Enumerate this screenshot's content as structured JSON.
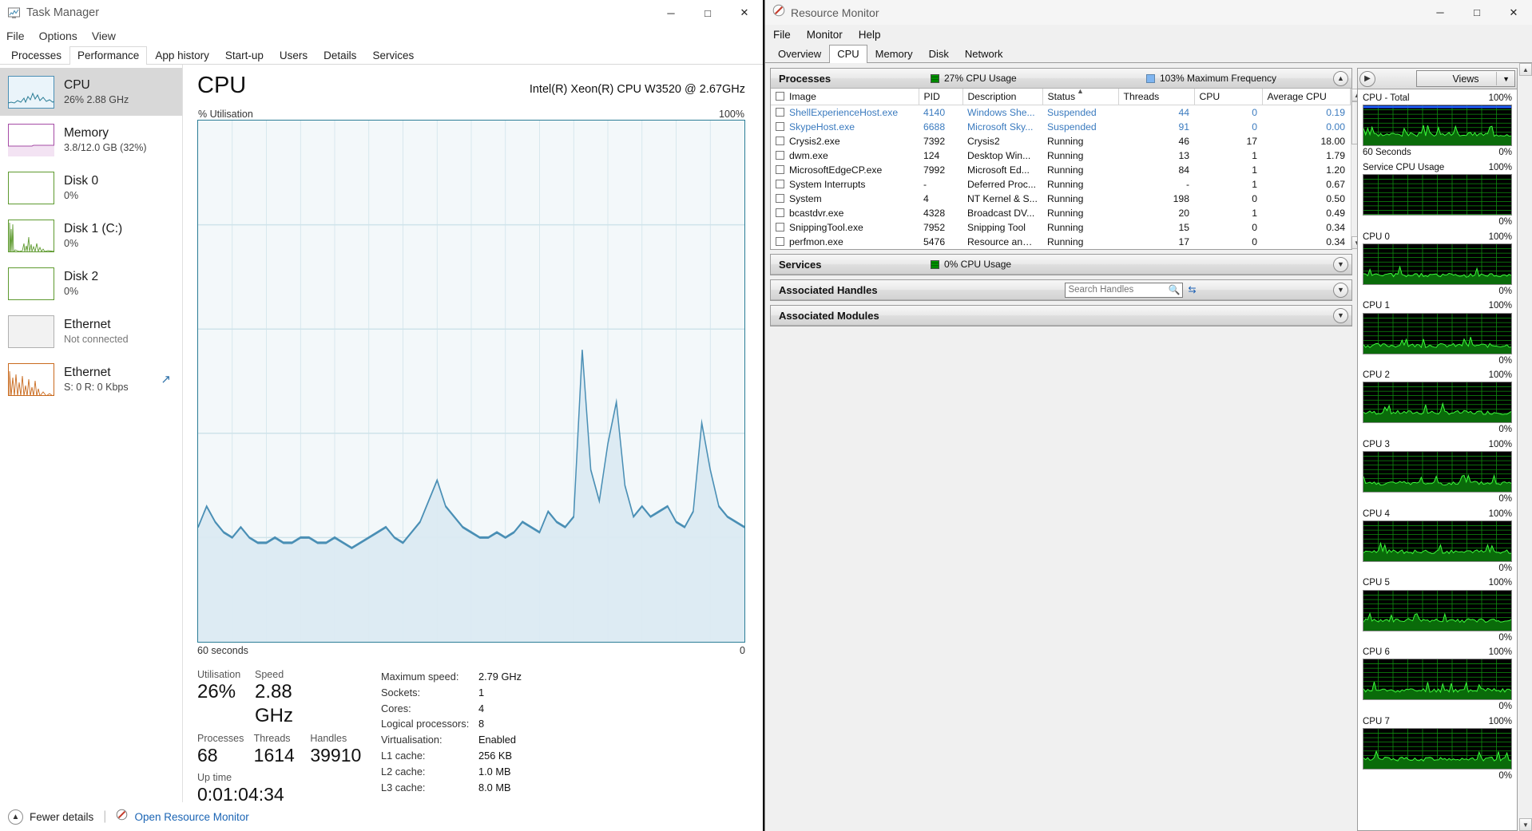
{
  "taskmanager": {
    "window_title": "Task Manager",
    "window_buttons": {
      "minimize": "─",
      "maximize": "□",
      "close": "✕"
    },
    "menu": [
      "File",
      "Options",
      "View"
    ],
    "tabs": [
      {
        "label": "Processes",
        "active": false
      },
      {
        "label": "Performance",
        "active": true
      },
      {
        "label": "App history",
        "active": false
      },
      {
        "label": "Start-up",
        "active": false
      },
      {
        "label": "Users",
        "active": false
      },
      {
        "label": "Details",
        "active": false
      },
      {
        "label": "Services",
        "active": false
      }
    ],
    "sidebar": [
      {
        "title": "CPU",
        "sub": "26%  2.88 GHz",
        "selected": true,
        "color": "#4a8fb5",
        "muted": false
      },
      {
        "title": "Memory",
        "sub": "3.8/12.0 GB (32%)",
        "selected": false,
        "color": "#a64ca6",
        "muted": false
      },
      {
        "title": "Disk 0",
        "sub": "0%",
        "selected": false,
        "color": "#5e9a2f",
        "muted": false
      },
      {
        "title": "Disk 1 (C:)",
        "sub": "0%",
        "selected": false,
        "color": "#5e9a2f",
        "muted": false
      },
      {
        "title": "Disk 2",
        "sub": "0%",
        "selected": false,
        "color": "#5e9a2f",
        "muted": false
      },
      {
        "title": "Ethernet",
        "sub": "Not connected",
        "selected": false,
        "color": "#b0b0b0",
        "muted": true
      },
      {
        "title": "Ethernet",
        "sub": "S: 0 R: 0 Kbps",
        "selected": false,
        "color": "#c96a1e",
        "muted": false
      }
    ],
    "detail": {
      "heading": "CPU",
      "cpu_name": "Intel(R) Xeon(R) CPU W3520 @ 2.67GHz",
      "graph_top_left": "% Utilisation",
      "graph_top_right": "100%",
      "graph_bottom_left": "60 seconds",
      "graph_bottom_right": "0",
      "stats": {
        "utilisation_label": "Utilisation",
        "utilisation_value": "26%",
        "speed_label": "Speed",
        "speed_value": "2.88 GHz",
        "processes_label": "Processes",
        "processes_value": "68",
        "threads_label": "Threads",
        "threads_value": "1614",
        "handles_label": "Handles",
        "handles_value": "39910",
        "uptime_label": "Up time",
        "uptime_value": "0:01:04:34"
      },
      "specs": [
        {
          "key": "Maximum speed:",
          "value": "2.79 GHz"
        },
        {
          "key": "Sockets:",
          "value": "1"
        },
        {
          "key": "Cores:",
          "value": "4"
        },
        {
          "key": "Logical processors:",
          "value": "8"
        },
        {
          "key": "Virtualisation:",
          "value": "Enabled"
        },
        {
          "key": "L1 cache:",
          "value": "256 KB"
        },
        {
          "key": "L2 cache:",
          "value": "1.0 MB"
        },
        {
          "key": "L3 cache:",
          "value": "8.0 MB"
        }
      ]
    },
    "footer": {
      "fewer_details": "Fewer details",
      "open_resource_monitor": "Open Resource Monitor"
    }
  },
  "resourcemonitor": {
    "window_title": "Resource Monitor",
    "window_buttons": {
      "minimize": "─",
      "maximize": "□",
      "close": "✕"
    },
    "menu": [
      "File",
      "Monitor",
      "Help"
    ],
    "tabs": [
      {
        "label": "Overview",
        "active": false
      },
      {
        "label": "CPU",
        "active": true
      },
      {
        "label": "Memory",
        "active": false
      },
      {
        "label": "Disk",
        "active": false
      },
      {
        "label": "Network",
        "active": false
      }
    ],
    "panels": {
      "processes": {
        "title": "Processes",
        "cpu_usage": "27% CPU Usage",
        "max_frequency": "103% Maximum Frequency"
      },
      "services": {
        "title": "Services",
        "cpu_usage": "0% CPU Usage"
      },
      "handles": {
        "title": "Associated Handles",
        "search_placeholder": "Search Handles",
        "search_value": ""
      },
      "modules": {
        "title": "Associated Modules"
      }
    },
    "process_table": {
      "columns": [
        "Image",
        "PID",
        "Description",
        "Status",
        "Threads",
        "CPU",
        "Average CPU"
      ],
      "rows": [
        {
          "image": "ShellExperienceHost.exe",
          "pid": "4140",
          "description": "Windows She...",
          "status": "Suspended",
          "threads": "44",
          "cpu": "0",
          "avg": "0.19",
          "suspended": true
        },
        {
          "image": "SkypeHost.exe",
          "pid": "6688",
          "description": "Microsoft Sky...",
          "status": "Suspended",
          "threads": "91",
          "cpu": "0",
          "avg": "0.00",
          "suspended": true
        },
        {
          "image": "Crysis2.exe",
          "pid": "7392",
          "description": "Crysis2",
          "status": "Running",
          "threads": "46",
          "cpu": "17",
          "avg": "18.00",
          "suspended": false
        },
        {
          "image": "dwm.exe",
          "pid": "124",
          "description": "Desktop Win...",
          "status": "Running",
          "threads": "13",
          "cpu": "1",
          "avg": "1.79",
          "suspended": false
        },
        {
          "image": "MicrosoftEdgeCP.exe",
          "pid": "7992",
          "description": "Microsoft Ed...",
          "status": "Running",
          "threads": "84",
          "cpu": "1",
          "avg": "1.20",
          "suspended": false
        },
        {
          "image": "System Interrupts",
          "pid": "-",
          "description": "Deferred Proc...",
          "status": "Running",
          "threads": "-",
          "cpu": "1",
          "avg": "0.67",
          "suspended": false
        },
        {
          "image": "System",
          "pid": "4",
          "description": "NT Kernel & S...",
          "status": "Running",
          "threads": "198",
          "cpu": "0",
          "avg": "0.50",
          "suspended": false
        },
        {
          "image": "bcastdvr.exe",
          "pid": "4328",
          "description": "Broadcast DV...",
          "status": "Running",
          "threads": "20",
          "cpu": "1",
          "avg": "0.49",
          "suspended": false
        },
        {
          "image": "SnippingTool.exe",
          "pid": "7952",
          "description": "Snipping Tool",
          "status": "Running",
          "threads": "15",
          "cpu": "0",
          "avg": "0.34",
          "suspended": false
        },
        {
          "image": "perfmon.exe",
          "pid": "5476",
          "description": "Resource and ...",
          "status": "Running",
          "threads": "17",
          "cpu": "0",
          "avg": "0.34",
          "suspended": false
        }
      ]
    },
    "views": {
      "expand_label": "›",
      "views_label": "Views",
      "dropdown": "▼"
    },
    "graphs": [
      {
        "label": "CPU - Total",
        "max": "100%",
        "min": "0%",
        "footer": "60 Seconds",
        "level": 27
      },
      {
        "label": "Service CPU Usage",
        "max": "100%",
        "min": "0%",
        "footer": "",
        "level": 0
      },
      {
        "label": "CPU 0",
        "max": "100%",
        "min": "0%",
        "footer": "",
        "level": 22
      },
      {
        "label": "CPU 1",
        "max": "100%",
        "min": "0%",
        "footer": "",
        "level": 20
      },
      {
        "label": "CPU 2",
        "max": "100%",
        "min": "0%",
        "footer": "",
        "level": 24
      },
      {
        "label": "CPU 3",
        "max": "100%",
        "min": "0%",
        "footer": "",
        "level": 21
      },
      {
        "label": "CPU 4",
        "max": "100%",
        "min": "0%",
        "footer": "",
        "level": 23
      },
      {
        "label": "CPU 5",
        "max": "100%",
        "min": "0%",
        "footer": "",
        "level": 25
      },
      {
        "label": "CPU 6",
        "max": "100%",
        "min": "0%",
        "footer": "",
        "level": 22
      },
      {
        "label": "CPU 7",
        "max": "100%",
        "min": "0%",
        "footer": "",
        "level": 24
      }
    ]
  },
  "chart_data": {
    "type": "area",
    "title": "% Utilisation",
    "xlabel": "60 seconds",
    "ylabel": "% Utilisation",
    "ylim": [
      0,
      100
    ],
    "xlim": [
      60,
      0
    ],
    "grid": true,
    "series": [
      {
        "name": "CPU Utilisation",
        "values": [
          22,
          26,
          23,
          21,
          20,
          22,
          20,
          19,
          19,
          20,
          19,
          19,
          20,
          20,
          19,
          19,
          20,
          19,
          18,
          19,
          20,
          21,
          22,
          20,
          19,
          21,
          23,
          27,
          31,
          26,
          24,
          22,
          21,
          20,
          20,
          21,
          20,
          21,
          23,
          22,
          21,
          25,
          23,
          22,
          24,
          56,
          33,
          27,
          38,
          46,
          30,
          24,
          26,
          24,
          25,
          26,
          23,
          22,
          25,
          42,
          33,
          26,
          24,
          23,
          22
        ]
      }
    ]
  }
}
